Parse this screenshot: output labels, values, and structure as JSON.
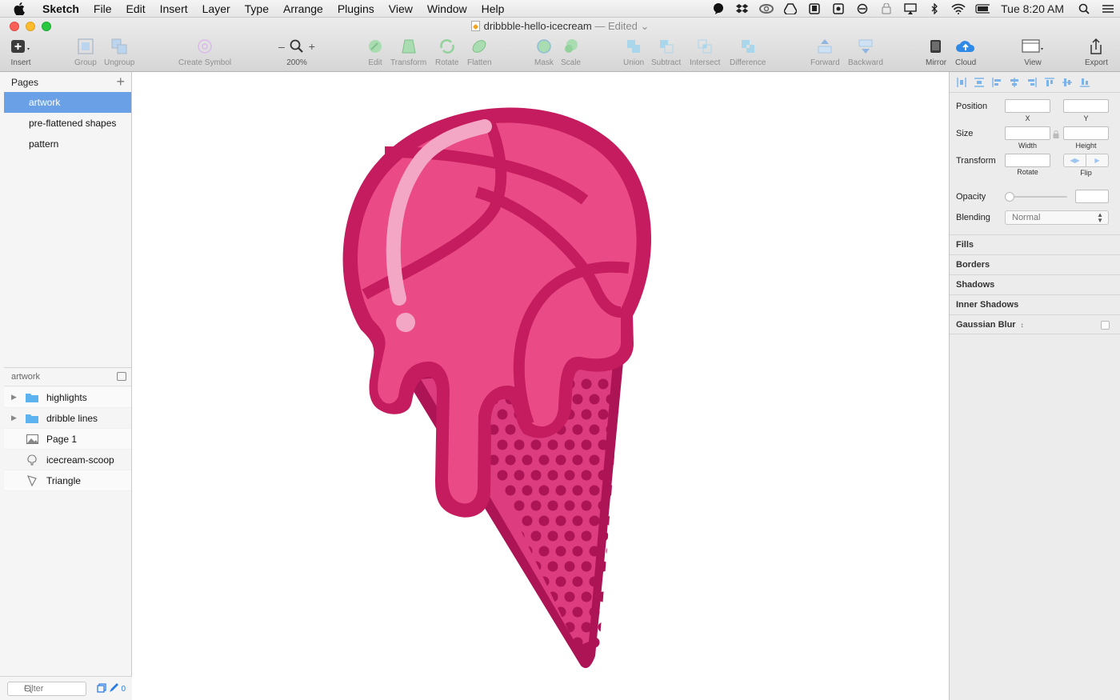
{
  "menubar": {
    "app_name": "Sketch",
    "items": [
      "File",
      "Edit",
      "Insert",
      "Layer",
      "Type",
      "Arrange",
      "Plugins",
      "View",
      "Window",
      "Help"
    ],
    "clock": "Tue 8:20 AM"
  },
  "window": {
    "doc_title": "dribbble-hello-icecream",
    "edited_label": "— Edited"
  },
  "toolbar": {
    "insert": "Insert",
    "group": "Group",
    "ungroup": "Ungroup",
    "create_symbol": "Create Symbol",
    "zoom_minus": "–",
    "zoom_plus": "+",
    "zoom_level": "200%",
    "edit": "Edit",
    "transform": "Transform",
    "rotate": "Rotate",
    "flatten": "Flatten",
    "mask": "Mask",
    "scale": "Scale",
    "union": "Union",
    "subtract": "Subtract",
    "intersect": "Intersect",
    "difference": "Difference",
    "forward": "Forward",
    "backward": "Backward",
    "mirror": "Mirror",
    "cloud": "Cloud",
    "view": "View",
    "export": "Export"
  },
  "pages": {
    "header": "Pages",
    "add_label": "+",
    "items": [
      {
        "label": "artwork"
      },
      {
        "label": "pre-flattened shapes"
      },
      {
        "label": "pattern"
      }
    ]
  },
  "layers": {
    "header": "artwork",
    "items": [
      {
        "label": "highlights",
        "icon": "folder-icon"
      },
      {
        "label": "dribble lines",
        "icon": "folder-icon"
      },
      {
        "label": "Page 1",
        "icon": "image-icon"
      },
      {
        "label": "icecream-scoop",
        "icon": "shape-icon"
      },
      {
        "label": "Triangle",
        "icon": "triangle-icon"
      }
    ]
  },
  "filter": {
    "placeholder": "Filter",
    "count": "0"
  },
  "inspector": {
    "position_label": "Position",
    "x_label": "X",
    "y_label": "Y",
    "size_label": "Size",
    "width_label": "Width",
    "height_label": "Height",
    "transform_label": "Transform",
    "rotate_label": "Rotate",
    "flip_label": "Flip",
    "opacity_label": "Opacity",
    "blending_label": "Blending",
    "blending_value": "Normal",
    "fills": "Fills",
    "borders": "Borders",
    "shadows": "Shadows",
    "inner_shadows": "Inner Shadows",
    "gaussian_blur": "Gaussian Blur"
  },
  "colors": {
    "accent": "#6aa0e6",
    "icecream_outline": "#c41c5e",
    "icecream_fill": "#ea4b87",
    "cone_dark": "#ad1456",
    "cone_fill": "#dd3c7e",
    "highlight": "#f4a7c5"
  }
}
